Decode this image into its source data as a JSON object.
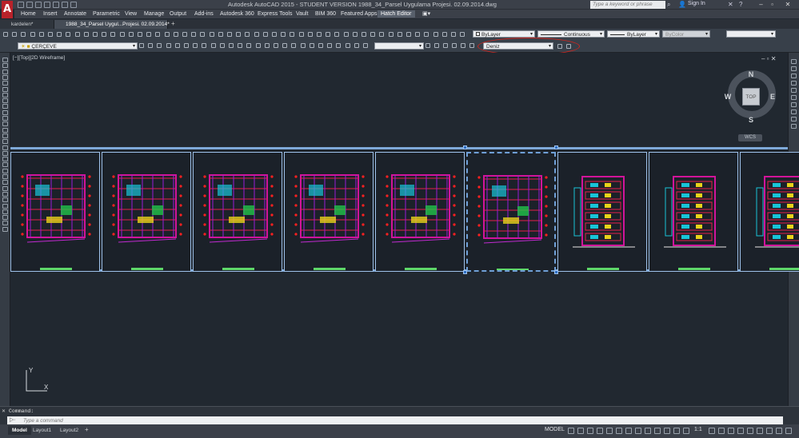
{
  "app": {
    "logo_letter": "A",
    "window_title": "Autodesk AutoCAD 2015 - STUDENT VERSION    1988_34_Parsel Uygulama Projesi. 02.09.2014.dwg",
    "search_placeholder": "Type a keyword or phrase",
    "sign_in": "Sign In"
  },
  "menu": {
    "items": [
      "Home",
      "Insert",
      "Annotate",
      "Parametric",
      "View",
      "Manage",
      "Output",
      "Add-ins",
      "Autodesk 360",
      "Express Tools",
      "Vault",
      "BIM 360",
      "Featured Apps"
    ],
    "active": "Hatch Editor"
  },
  "tabs": [
    {
      "label": "kardelen*"
    },
    {
      "label": "1988_34_Parsel Uygul...Projesi. 02.09.2014*"
    }
  ],
  "toolbars": {
    "layer_select": "BYLAYER",
    "linetype": "Continuous",
    "lineweight": "ByLayer",
    "plotstyle": "ByColor",
    "color": "ByLayer",
    "layer_current": "ÇERÇEVE",
    "highlighted_dropdown": "Deniz"
  },
  "viewport": {
    "label": "[−][Top][2D Wireframe]",
    "viewcube": {
      "top": "TOP",
      "n": "N",
      "s": "S",
      "e": "E",
      "w": "W",
      "wcs": "WCS"
    }
  },
  "command": {
    "history": "Command:",
    "placeholder": "Type a command"
  },
  "status": {
    "layout_tabs": [
      "Model",
      "Layout1",
      "Layout2"
    ],
    "model": "MODEL",
    "scale": "1:1"
  },
  "colors": {
    "accent_selection": "#7ea9d8",
    "annotation_red": "#d0261f"
  }
}
